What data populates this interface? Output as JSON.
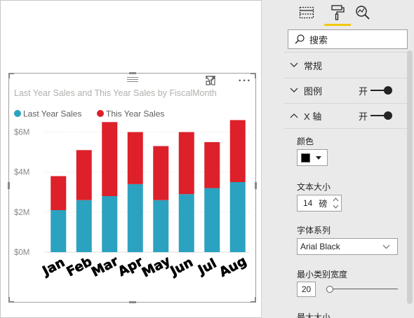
{
  "visual": {
    "more_label": "···"
  },
  "chart_data": {
    "type": "bar",
    "stacked": true,
    "title": "Last Year Sales and This Year Sales by FiscalMonth",
    "categories": [
      "Jan",
      "Feb",
      "Mar",
      "Apr",
      "May",
      "Jun",
      "Jul",
      "Aug"
    ],
    "series": [
      {
        "name": "Last Year Sales",
        "color": "#2ba2c0",
        "values": [
          2.1,
          2.6,
          2.8,
          3.4,
          2.6,
          2.9,
          3.2,
          3.5
        ]
      },
      {
        "name": "This Year Sales",
        "color": "#dd202a",
        "values": [
          1.7,
          2.5,
          3.7,
          2.6,
          2.7,
          3.1,
          2.3,
          3.1
        ]
      }
    ],
    "ylim": [
      0,
      7
    ],
    "yticks": [
      0,
      2,
      4,
      6
    ],
    "ytick_labels": [
      "$0M",
      "$2M",
      "$4M",
      "$6M"
    ],
    "legend_position": "top-left",
    "grid": true
  },
  "pane": {
    "search_placeholder": "搜索",
    "sections": [
      {
        "label": "常规",
        "expanded": false
      },
      {
        "label": "图例",
        "expanded": false,
        "state": "开"
      },
      {
        "label": "X 轴",
        "expanded": true,
        "state": "开"
      }
    ],
    "x_axis": {
      "color_label": "颜色",
      "color_value": "#000000",
      "text_size_label": "文本大小",
      "text_size_value": "14",
      "text_size_unit": "磅",
      "font_family_label": "字体系列",
      "font_family_value": "Arial Black",
      "min_category_width_label": "最小类别宽度",
      "min_category_width_value": "20",
      "next_label": "最大大小"
    }
  }
}
